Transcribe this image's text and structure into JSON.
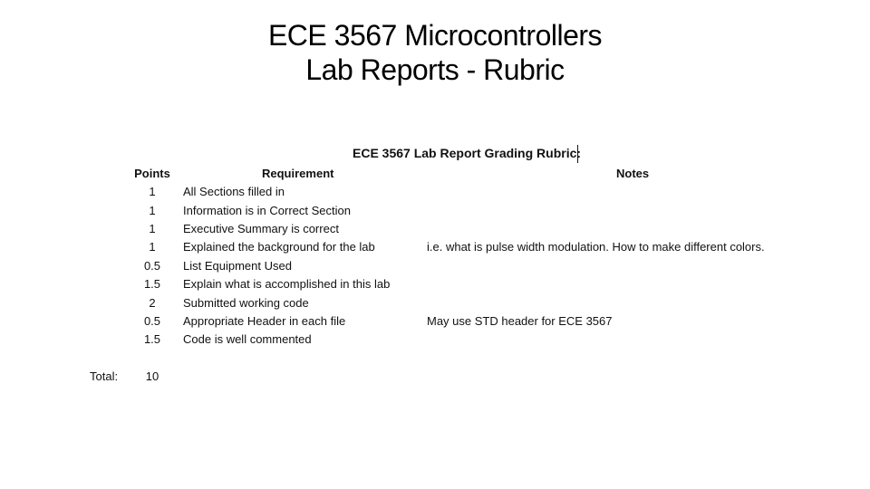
{
  "slide": {
    "title_line1": "ECE 3567 Microcontrollers",
    "title_line2": "Lab Reports - Rubric"
  },
  "rubric": {
    "caption": "ECE 3567 Lab Report Grading Rubric:",
    "headers": {
      "points": "Points",
      "requirement": "Requirement",
      "notes": "Notes"
    },
    "rows": [
      {
        "points": "1",
        "requirement": "All Sections filled in",
        "notes": ""
      },
      {
        "points": "1",
        "requirement": "Information is in Correct Section",
        "notes": ""
      },
      {
        "points": "1",
        "requirement": "Executive Summary is correct",
        "notes": ""
      },
      {
        "points": "1",
        "requirement": "Explained the background for the lab",
        "notes": "i.e. what is pulse width modulation.  How to make different colors."
      },
      {
        "points": "0.5",
        "requirement": "List Equipment Used",
        "notes": ""
      },
      {
        "points": "1.5",
        "requirement": "Explain what is accomplished in this lab",
        "notes": ""
      },
      {
        "points": "2",
        "requirement": "Submitted working code",
        "notes": ""
      },
      {
        "points": "0.5",
        "requirement": "Appropriate Header in each file",
        "notes": "May use STD header for ECE 3567"
      },
      {
        "points": "1.5",
        "requirement": "Code is well commented",
        "notes": ""
      }
    ],
    "total_label": "Total:",
    "total_value": "10"
  }
}
